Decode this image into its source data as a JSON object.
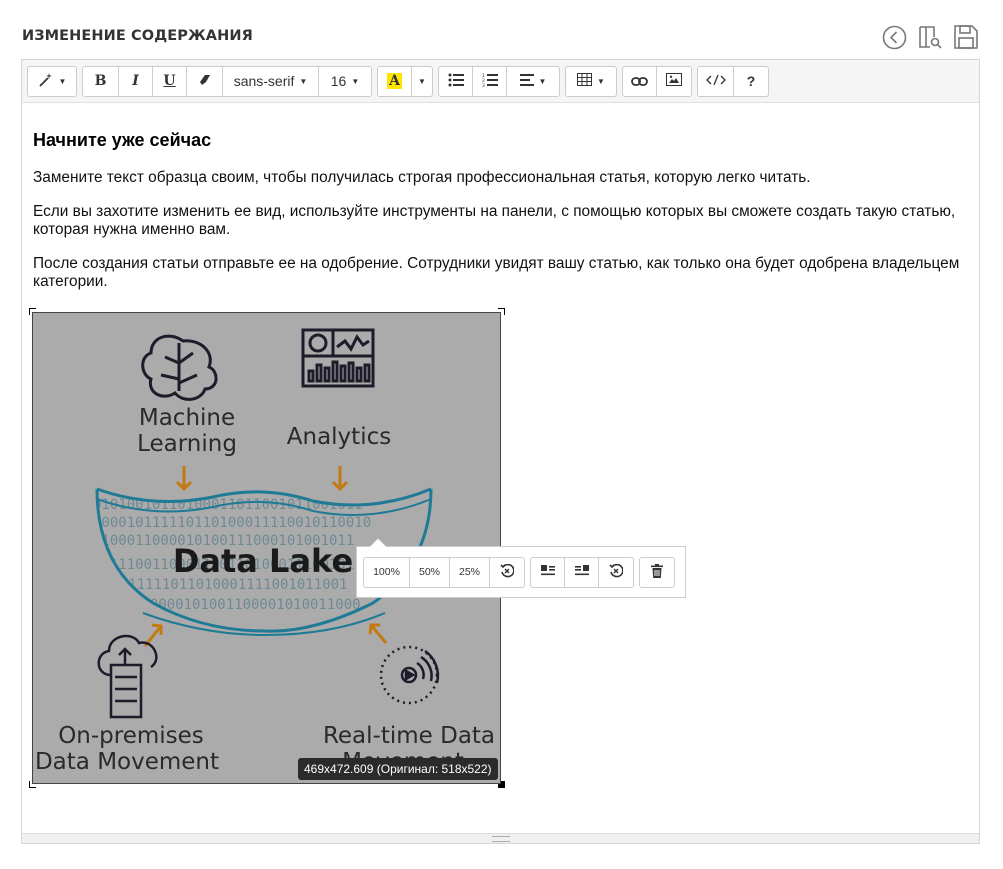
{
  "header": {
    "title": "Изменение содержания",
    "icons": [
      "back-icon",
      "preview-icon",
      "save-icon"
    ]
  },
  "toolbar": {
    "font_family": "sans-serif",
    "font_size": "16",
    "highlight_letter": "A",
    "highlight_color": "#ffe600",
    "bold": "B",
    "italic": "I",
    "underline": "U",
    "help": "?"
  },
  "content": {
    "heading": "Начните уже сейчас",
    "paragraphs": [
      "Замените текст образца своим, чтобы получилась строгая профессиональная статья, которую легко читать.",
      "Если вы захотите изменить ее вид, используйте инструменты на панели, с помощью которых вы сможете создать такую статью, которая нужна именно вам.",
      "После создания статьи отправьте ее на одобрение. Сотрудники увидят вашу статью, как только она будет одобрена владельцем категории."
    ]
  },
  "image": {
    "labels": {
      "ml_line1": "Machine",
      "ml_line2": "Learning",
      "analytics": "Analytics",
      "lake": "Data Lake",
      "onprem_line1": "On-premises",
      "onprem_line2": "Data Movement",
      "realtime_line1": "Real-time Data",
      "realtime_line2": "Movement"
    },
    "binary_rows": [
      "01010010110100011011001011001011",
      "000010111110110100011110010110010",
      "1100011000010100111000101001011",
      "1011100110001110110100011100101",
      "01011111011010001111001011001",
      "110000101001100001010011000"
    ],
    "size_badge": "469x472.609 (Оригинал: 518x522)",
    "arrow_color": "#c47a12",
    "lake_color": "#1f7a96"
  },
  "image_popover": {
    "size_100": "100%",
    "size_50": "50%",
    "size_25": "25%"
  }
}
